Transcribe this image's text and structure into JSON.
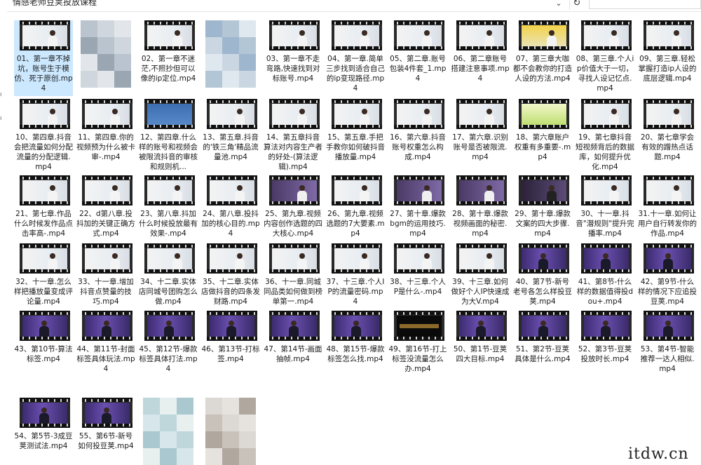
{
  "window": {
    "path": "情感老师豆荚投放课程",
    "refresh_icon": "refresh-icon",
    "dropdown_icon": "chevron-down-icon"
  },
  "left_edge": [
    "",
    "ı",
    "ı"
  ],
  "files": [
    {
      "name": "01、第一章不掉坑，账号生于模仿、死于原创.mp4",
      "thumb": "light",
      "selected": true
    },
    {
      "name": "",
      "thumb": "blurred"
    },
    {
      "name": "02、第一章不迷茫,不照抄但可以像的ip定位.mp4",
      "thumb": "light"
    },
    {
      "name": "",
      "thumb": "blurred"
    },
    {
      "name": "03、第一章不走弯路,快速找到对标账号.mp4",
      "thumb": "light"
    },
    {
      "name": "04、第一章.简单三步找到适合自己的ip变现路径.mp4",
      "thumb": "light"
    },
    {
      "name": "05、第二章.账号包装4件套_1.mp4",
      "thumb": "light"
    },
    {
      "name": "06、第二章账号搭建注意事项.mp4",
      "thumb": "light"
    },
    {
      "name": "07、第三章大咖都不会教你的打造人设的方法.mp4",
      "thumb": "yellow"
    },
    {
      "name": "08、第三章.个人ip价值大于一切，寻找人设记忆点.mp4",
      "thumb": "light"
    },
    {
      "name": "09、第三章.轻松掌握打造ip人设的底层逻辑.mp4",
      "thumb": "light"
    },
    {
      "name": "10、第四章.抖音会把流量如何分配流量的分配逻辑.mp4",
      "thumb": "light"
    },
    {
      "name": "11、第四章.你的视频预为什么被卡审-.mp4",
      "thumb": "light"
    },
    {
      "name": "12、第四章.什么样的账号和视频会被限流抖音的审核和规则机...",
      "thumb": "blue"
    },
    {
      "name": "13、第五章.抖音的'铁三角'精品流量池.mp4",
      "thumb": "light"
    },
    {
      "name": "14、第五章抖音算法对内容生产者的好处-(算法逻辑).mp4",
      "thumb": "light"
    },
    {
      "name": "15、第五章.手把手教你如何破抖音播放量.mp4",
      "thumb": "light"
    },
    {
      "name": "16、第六章.抖音账号权重怎么构成.mp4",
      "thumb": "light"
    },
    {
      "name": "17、第六章.识别账号是否被限流.mp4",
      "thumb": "light"
    },
    {
      "name": "18、第六章账户权重有多重要-.mp4",
      "thumb": "green"
    },
    {
      "name": "19、第七章抖音短视频背后的数据库，如何提升优化.mp4",
      "thumb": "light"
    },
    {
      "name": "20、第七章学会有效的蹭热点话题.mp4",
      "thumb": "light"
    },
    {
      "name": "21、第七章.作品什么时候发作品点击率高-.mp4",
      "thumb": "light"
    },
    {
      "name": "22、d第八章.投抖加的关键正确方式.mp4",
      "thumb": "light"
    },
    {
      "name": "23、第八章.抖加什么时候投放最有效果-.mp4",
      "thumb": "light"
    },
    {
      "name": "24、第八章.投抖加的核心目的.mp4",
      "thumb": "light"
    },
    {
      "name": "25、第九章.视频内容创作选题的四大核心.mp4",
      "thumb": "purple"
    },
    {
      "name": "26、第九章.视频选题的7大要素.mp4",
      "thumb": "light"
    },
    {
      "name": "27、第十章.爆款bgm的运用技巧.mp4",
      "thumb": "purple"
    },
    {
      "name": "28、第十章.爆款视频画面的秘密.mp4",
      "thumb": "purple"
    },
    {
      "name": "29、第十章.爆款文案的四大步骤.mp4",
      "thumb": "dark"
    },
    {
      "name": "30、十一章.抖音\"潜规则\"提升完播率.mp4",
      "thumb": "light"
    },
    {
      "name": "31.十一章.如何让用户自行转发你的作品.mp4",
      "thumb": "light"
    },
    {
      "name": "32、十一章.怎么样把播放量变成评论量.mp4",
      "thumb": "light"
    },
    {
      "name": "33、十一章.增加抖音点赞量的技巧.mp4",
      "thumb": "light"
    },
    {
      "name": "34、十二章.实体店同城号团购怎么做.mp4",
      "thumb": "light"
    },
    {
      "name": "35、十二章.实体店做抖音的四条发财路.mp4",
      "thumb": "light"
    },
    {
      "name": "36、十一章.同城同品类如何做到榜单第一.mp4",
      "thumb": "light"
    },
    {
      "name": "37、十三章.个人IP的流量密码.mp4",
      "thumb": "light"
    },
    {
      "name": "38、十三章.个人P是什么-.mp4",
      "thumb": "light"
    },
    {
      "name": "39、十三章.如何做好个人IP快速成为大V.mp4",
      "thumb": "light"
    },
    {
      "name": "40、第7节-新号老号各怎么样投豆荚.mp4",
      "thumb": "stage"
    },
    {
      "name": "41、第8节-什么样的数据值得投dou+.mp4",
      "thumb": "stage"
    },
    {
      "name": "42、第9节-什么样的情况下应追投豆荚.mp4",
      "thumb": "stage"
    },
    {
      "name": "43、第10节-算法标签.mp4",
      "thumb": "stage"
    },
    {
      "name": "44、第11节-封面标签具体玩法.mp4",
      "thumb": "stage"
    },
    {
      "name": "45、第12节-爆款标签具体打法.mp4",
      "thumb": "stage"
    },
    {
      "name": "46、第13节-打标签.mp4",
      "thumb": "stage"
    },
    {
      "name": "47、第14节-画面抽帧.mp4",
      "thumb": "stage"
    },
    {
      "name": "48、第15节-爆款标签怎么找.mp4",
      "thumb": "stage"
    },
    {
      "name": "49、第16节-打上标签没流量怎么办.mp4",
      "thumb": "black"
    },
    {
      "name": "50、第1节-豆荚四大目标.mp4",
      "thumb": "stage"
    },
    {
      "name": "51、第2节-豆荚具体是什么.mp4",
      "thumb": "stage"
    },
    {
      "name": "52、第3节-豆荚投放时长.mp4",
      "thumb": "stage"
    },
    {
      "name": "53、第4节-智能推荐一达人相似.mp4",
      "thumb": "stage"
    },
    {
      "name": "54、第5节-3成豆荚测试法.mp4",
      "thumb": "stage"
    },
    {
      "name": "55、第6节-新号如何投豆荚.mp4",
      "thumb": "stage"
    },
    {
      "name": "",
      "thumb": "blurred"
    },
    {
      "name": "",
      "thumb": "blurred"
    }
  ],
  "watermark": "itdw.cn"
}
